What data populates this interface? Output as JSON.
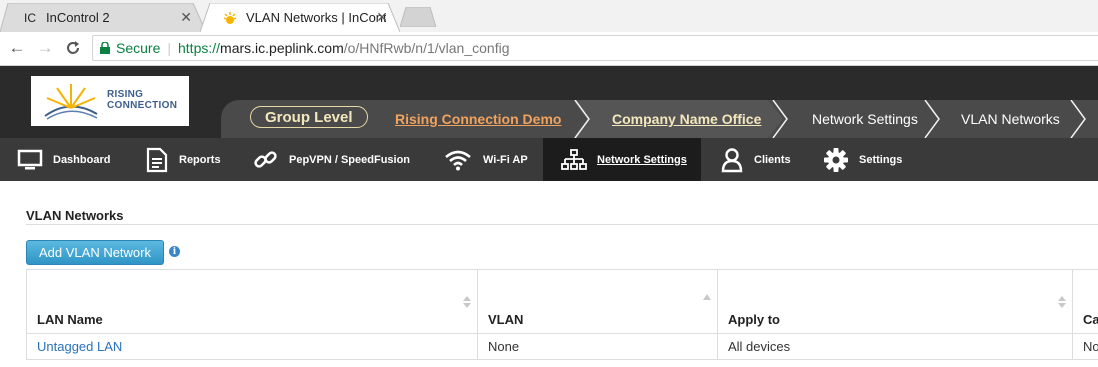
{
  "browser": {
    "tabs": [
      {
        "favicon": "IC",
        "title": "InControl 2",
        "active": false
      },
      {
        "favicon": "sun-logo-icon",
        "title": "VLAN Networks | InContr",
        "active": true
      }
    ],
    "address": {
      "secure_label": "Secure",
      "url_scheme": "https://",
      "url_host": "mars.ic.peplink.com",
      "url_path": "/o/HNfRwb/n/1/vlan_config"
    }
  },
  "header": {
    "logo_line1": "RISING",
    "logo_line2": "CONNECTION",
    "breadcrumbs": {
      "group_level": "Group Level",
      "organization": "Rising Connection Demo",
      "office": "Company Name Office",
      "section": "Network Settings",
      "page": "VLAN Networks"
    }
  },
  "menu": {
    "items": [
      {
        "label": "Dashboard",
        "icon": "monitor-icon"
      },
      {
        "label": "Reports",
        "icon": "document-icon"
      },
      {
        "label": "PepVPN / SpeedFusion",
        "icon": "link-icon"
      },
      {
        "label": "Wi-Fi AP",
        "icon": "wifi-icon"
      },
      {
        "label": "Network Settings",
        "icon": "network-icon",
        "active": true
      },
      {
        "label": "Clients",
        "icon": "user-icon"
      },
      {
        "label": "Settings",
        "icon": "gear-icon"
      }
    ]
  },
  "content": {
    "section_title": "VLAN Networks",
    "add_button": "Add VLAN Network",
    "table": {
      "headers": [
        "LAN Name",
        "VLAN",
        "Apply to",
        "Ca"
      ],
      "rows": [
        {
          "lan_name": "Untagged LAN",
          "vlan": "None",
          "apply_to": "All devices",
          "extra": "No"
        }
      ]
    }
  },
  "colors": {
    "accent": "#2f95c6",
    "org_link": "#f0a35f",
    "header_bg": "#2b2b2b",
    "link": "#2a72b8"
  }
}
